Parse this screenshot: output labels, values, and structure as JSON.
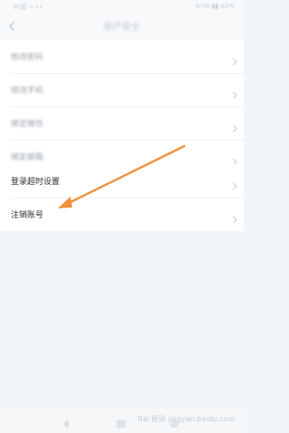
{
  "status_bar": {
    "left_text": "中国 ••• ",
    "right_text": "8:08 ▮▮ 62%"
  },
  "header": {
    "title": "账户安全",
    "back_icon": "back-arrow-icon"
  },
  "settings_group_1": [
    {
      "label": "修改密码"
    },
    {
      "label": "修改手机"
    },
    {
      "label": "绑定微信"
    },
    {
      "label": "绑定邮箱"
    }
  ],
  "settings_group_2": [
    {
      "label": "登录超时设置"
    },
    {
      "label": "注销账号"
    }
  ],
  "annotation": {
    "arrow_color": "#f0913a"
  },
  "nav_bar": {
    "icons": [
      "nav-back-icon",
      "nav-home-icon",
      "nav-recent-icon"
    ],
    "watermark": "Bai 经验 jingyan.baidu.com"
  },
  "colors": {
    "background": "#f3f6f9",
    "card": "#ffffff",
    "divider": "#eef0f2",
    "chevron": "#c9cdd1"
  }
}
